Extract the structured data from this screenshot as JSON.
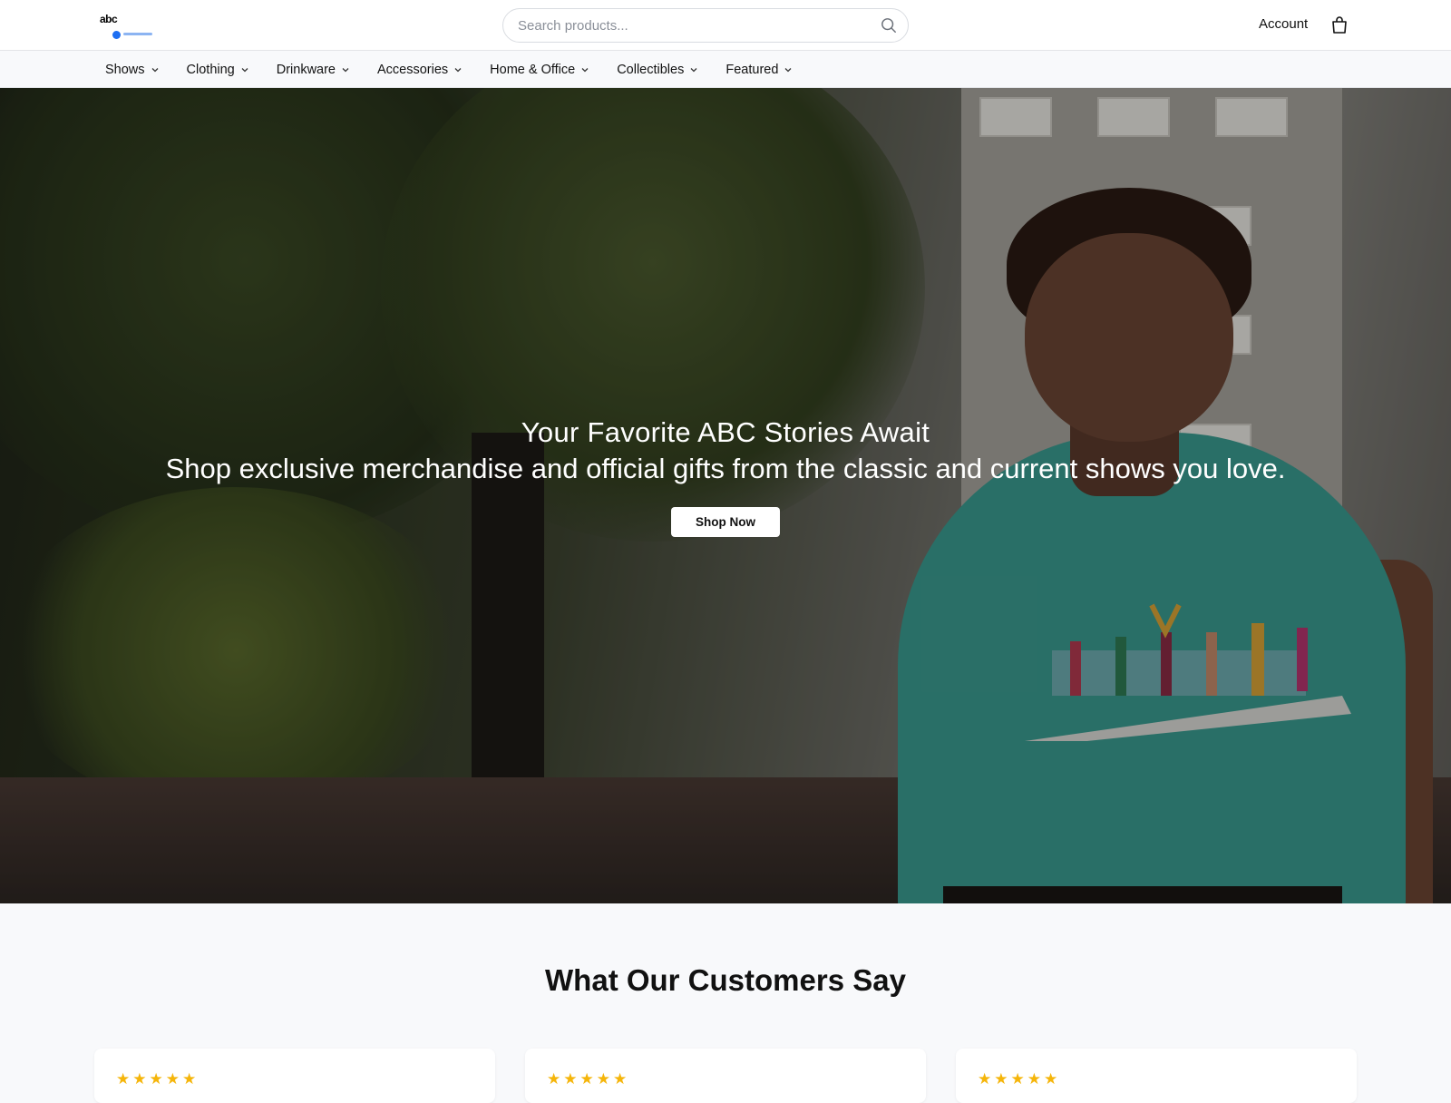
{
  "header": {
    "logo_text": "abc",
    "search_placeholder": "Search products...",
    "account_label": "Account"
  },
  "nav": {
    "items": [
      {
        "label": "Shows"
      },
      {
        "label": "Clothing"
      },
      {
        "label": "Drinkware"
      },
      {
        "label": "Accessories"
      },
      {
        "label": "Home & Office"
      },
      {
        "label": "Collectibles"
      },
      {
        "label": "Featured"
      }
    ]
  },
  "hero": {
    "title": "Your Favorite ABC Stories Await",
    "subtitle": "Shop exclusive merchandise and official gifts from the classic and current shows you love.",
    "cta_label": "Shop Now"
  },
  "testimonials": {
    "heading": "What Our Customers Say",
    "cards": [
      {
        "stars": "★★★★★",
        "rating": 5
      },
      {
        "stars": "★★★★★",
        "rating": 5
      },
      {
        "stars": "★★★★★",
        "rating": 5
      }
    ]
  },
  "colors": {
    "accent_star": "#f5b50a",
    "shirt_teal": "#3a9a8f",
    "logo_blue": "#1d6ff2"
  },
  "icons": [
    "search-icon",
    "shopping-bag-icon",
    "chevron-down-icon",
    "star-icon"
  ]
}
